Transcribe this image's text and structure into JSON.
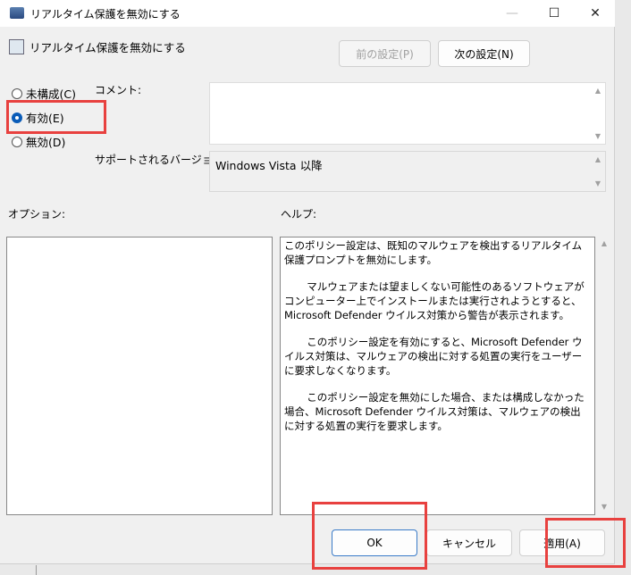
{
  "window": {
    "title": "リアルタイム保護を無効にする",
    "minimize": "—",
    "maximize": "☐",
    "close": "✕"
  },
  "header": {
    "policy_title": "リアルタイム保護を無効にする",
    "prev_label": "前の設定(P)",
    "next_label": "次の設定(N)"
  },
  "state": {
    "options": [
      {
        "label": "未構成(C)",
        "selected": false
      },
      {
        "label": "有効(E)",
        "selected": true
      },
      {
        "label": "無効(D)",
        "selected": false
      }
    ]
  },
  "comment": {
    "label": "コメント:",
    "value": ""
  },
  "supported": {
    "label": "サポートされるバージョン:",
    "value": "Windows Vista 以降"
  },
  "options_panel": {
    "label": "オプション:"
  },
  "help": {
    "label": "ヘルプ:",
    "paragraphs": [
      "このポリシー設定は、既知のマルウェアを検出するリアルタイム保護プロンプトを無効にします。",
      "マルウェアまたは望ましくない可能性のあるソフトウェアがコンピューター上でインストールまたは実行されようとすると、Microsoft Defender ウイルス対策から警告が表示されます。",
      "このポリシー設定を有効にすると、Microsoft Defender ウイルス対策は、マルウェアの検出に対する処置の実行をユーザーに要求しなくなります。",
      "このポリシー設定を無効にした場合、または構成しなかった場合、Microsoft Defender ウイルス対策は、マルウェアの検出に対する処置の実行を要求します。"
    ]
  },
  "footer": {
    "ok": "OK",
    "cancel": "キャンセル",
    "apply": "適用(A)"
  },
  "colors": {
    "highlight": "#e8413f",
    "accent": "#0a5cb8"
  }
}
